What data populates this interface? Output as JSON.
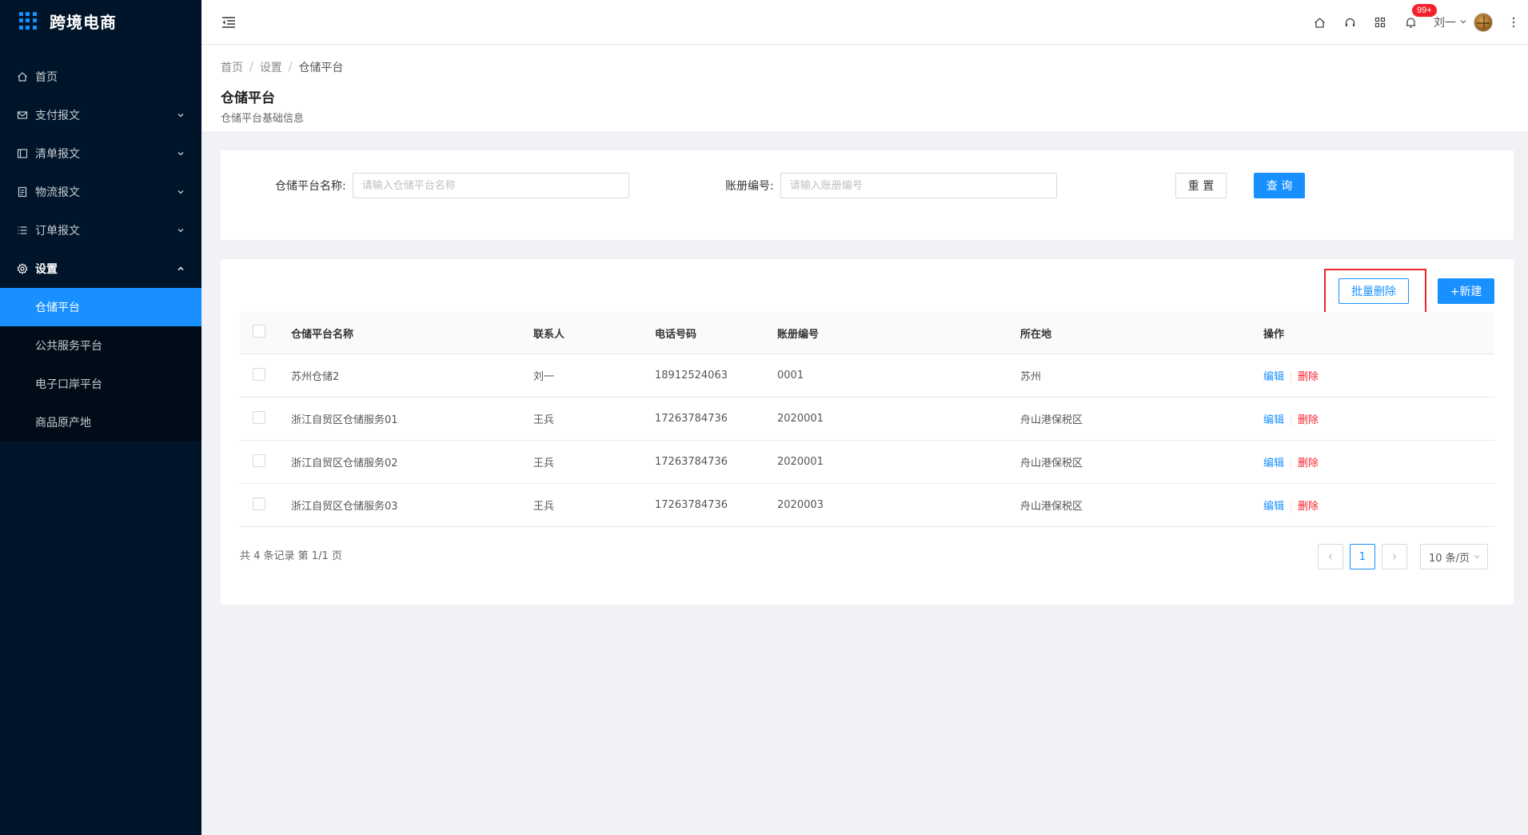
{
  "app": {
    "title": "跨境电商"
  },
  "sidebar": {
    "items": [
      {
        "label": "首页",
        "icon": "home-icon"
      },
      {
        "label": "支付报文",
        "icon": "mail-icon"
      },
      {
        "label": "清单报文",
        "icon": "layout-icon"
      },
      {
        "label": "物流报文",
        "icon": "file-icon"
      },
      {
        "label": "订单报文",
        "icon": "list-icon"
      },
      {
        "label": "设置",
        "icon": "gear-icon"
      }
    ],
    "sub_items": [
      {
        "label": "仓储平台",
        "active": true
      },
      {
        "label": "公共服务平台"
      },
      {
        "label": "电子口岸平台"
      },
      {
        "label": "商品原产地"
      }
    ]
  },
  "header": {
    "notification_count": "99+",
    "user_name": "刘一"
  },
  "breadcrumb": [
    "首页",
    "设置",
    "仓储平台"
  ],
  "page": {
    "title": "仓储平台",
    "subtitle": "仓储平台基础信息"
  },
  "search": {
    "name_label": "仓储平台名称:",
    "name_placeholder": "请输入仓储平台名称",
    "book_label": "账册编号:",
    "book_placeholder": "请输入账册编号",
    "reset_label": "重 置",
    "query_label": "查 询"
  },
  "toolbar": {
    "batch_delete_label": "批量删除",
    "new_label": "+新建"
  },
  "table": {
    "columns": [
      "仓储平台名称",
      "联系人",
      "电话号码",
      "账册编号",
      "所在地",
      "操作"
    ],
    "rows": [
      {
        "name": "苏州仓储2",
        "contact": "刘一",
        "phone": "18912524063",
        "book": "0001",
        "location": "苏州"
      },
      {
        "name": "浙江自贸区仓储服务01",
        "contact": "王兵",
        "phone": "17263784736",
        "book": "2020001",
        "location": "舟山港保税区"
      },
      {
        "name": "浙江自贸区仓储服务02",
        "contact": "王兵",
        "phone": "17263784736",
        "book": "2020001",
        "location": "舟山港保税区"
      },
      {
        "name": "浙江自贸区仓储服务03",
        "contact": "王兵",
        "phone": "17263784736",
        "book": "2020003",
        "location": "舟山港保税区"
      }
    ],
    "edit_label": "编辑",
    "delete_label": "删除"
  },
  "pagination": {
    "summary": "共 4 条记录 第 1/1 页",
    "current_page": "1",
    "page_size": "10 条/页"
  },
  "colors": {
    "sidebar_bg": "#001529",
    "primary": "#1890ff",
    "danger": "#f5222d",
    "highlight": "#e8272a"
  }
}
